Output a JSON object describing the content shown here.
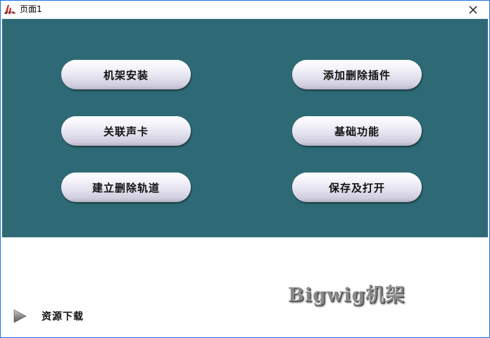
{
  "window": {
    "title": "页面1"
  },
  "main": {
    "left_buttons": [
      {
        "label": "机架安装"
      },
      {
        "label": "关联声卡"
      },
      {
        "label": "建立删除轨道"
      }
    ],
    "right_buttons": [
      {
        "label": "添加删除插件"
      },
      {
        "label": "基础功能"
      },
      {
        "label": "保存及打开"
      }
    ],
    "background_color": "#2e6a75"
  },
  "footer": {
    "logo_text": "Bigwig机架",
    "download_label": "资源下载"
  },
  "icons": {
    "app": "app-logo-icon",
    "close": "close-icon",
    "download": "play-triangle-icon"
  }
}
